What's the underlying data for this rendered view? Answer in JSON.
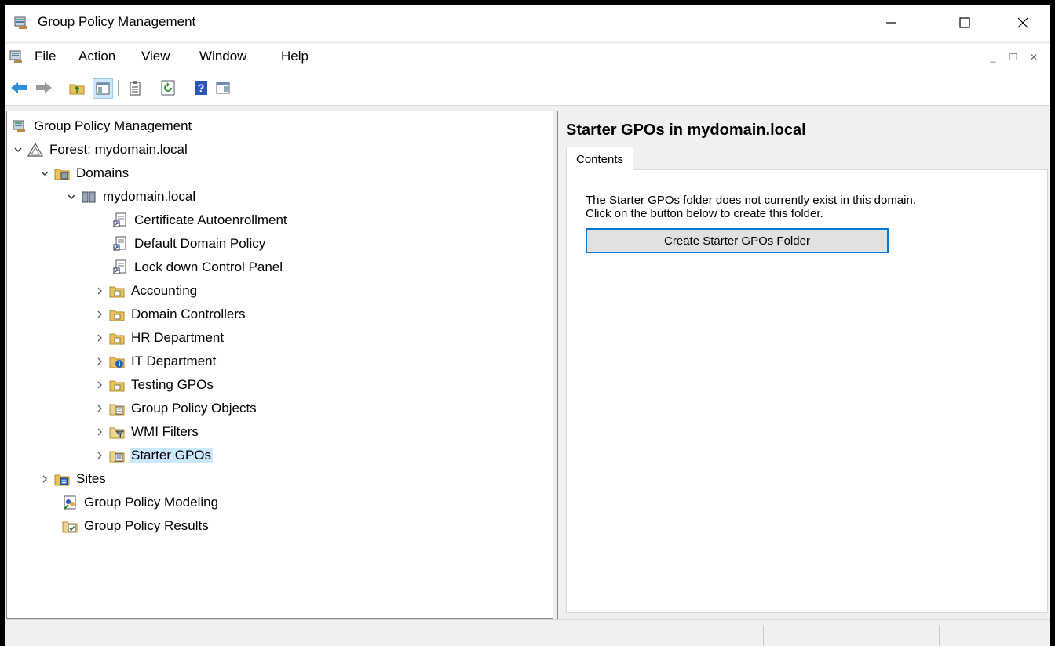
{
  "window": {
    "title": "Group Policy Management",
    "controls": {
      "minimize": "minimize",
      "maximize": "maximize",
      "close": "close"
    }
  },
  "menu": {
    "items": [
      "File",
      "Action",
      "View",
      "Window",
      "Help"
    ]
  },
  "toolbar": {
    "buttons": [
      "back-arrow-icon",
      "forward-arrow-icon",
      "up-folder-icon",
      "show-hide-tree-icon",
      "properties-icon",
      "refresh-icon",
      "help-icon",
      "show-action-pane-icon"
    ]
  },
  "tree": {
    "root": "Group Policy Management",
    "forest": "Forest: mydomain.local",
    "domains": "Domains",
    "domain": "mydomain.local",
    "gpo_links": [
      "Certificate Autoenrollment",
      "Default Domain Policy",
      "Lock down Control Panel"
    ],
    "ous": [
      "Accounting",
      "Domain Controllers",
      "HR Department",
      "IT Department",
      "Testing GPOs"
    ],
    "containers": [
      "Group Policy Objects",
      "WMI Filters",
      "Starter GPOs"
    ],
    "sites": "Sites",
    "modeling": "Group Policy Modeling",
    "results": "Group Policy Results",
    "selected": "Starter GPOs"
  },
  "details": {
    "title": "Starter GPOs in mydomain.local",
    "tab": "Contents",
    "message_line1": "The Starter GPOs folder does not currently exist in this domain.",
    "message_line2": "Click on the button below to create this folder.",
    "button": "Create Starter GPOs Folder"
  },
  "colors": {
    "selection": "#cce8ff",
    "button_border": "#0078d7"
  }
}
